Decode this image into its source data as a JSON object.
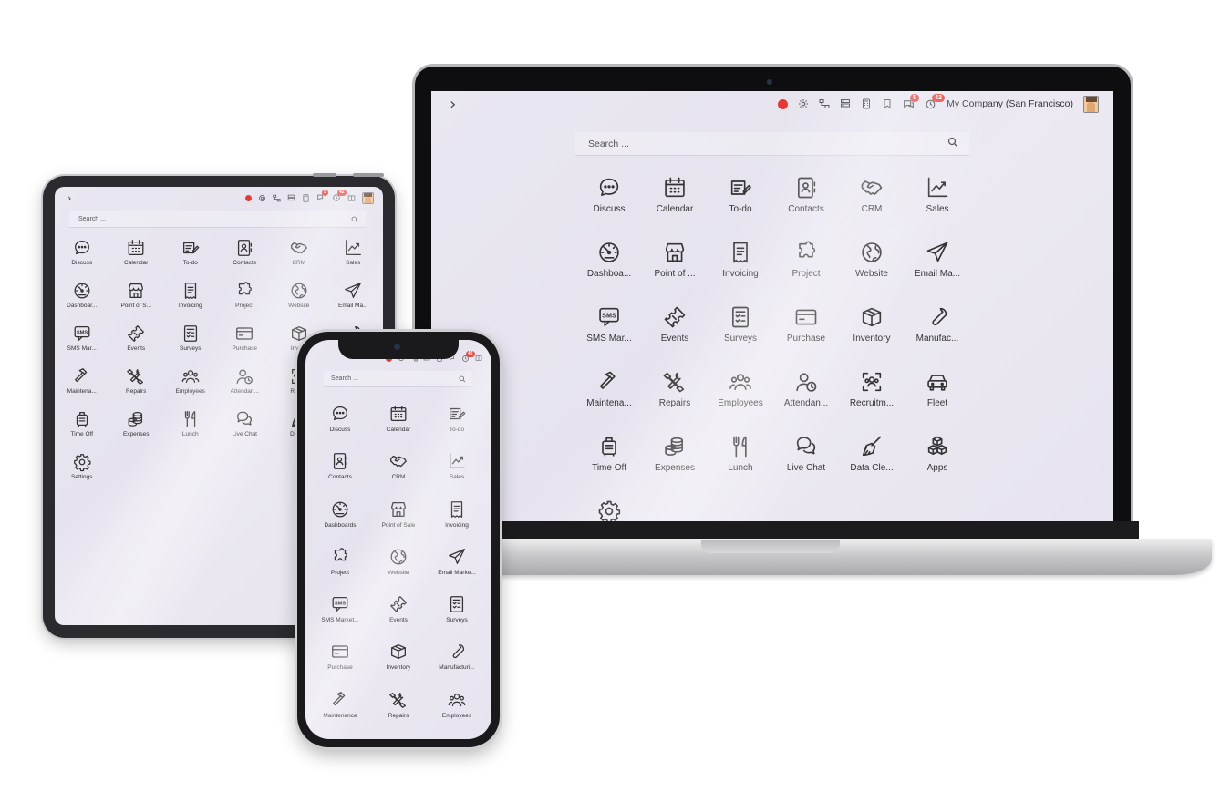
{
  "apps": [
    {
      "name": "Discuss",
      "icon": "chat-bubble-icon"
    },
    {
      "name": "Calendar",
      "icon": "calendar-icon"
    },
    {
      "name": "To-do",
      "icon": "todo-icon"
    },
    {
      "name": "Contacts",
      "icon": "contacts-icon"
    },
    {
      "name": "CRM",
      "icon": "handshake-icon"
    },
    {
      "name": "Sales",
      "icon": "chart-line-icon"
    },
    {
      "name": "Dashboards",
      "icon": "dashboard-gauge-icon"
    },
    {
      "name": "Point of Sale",
      "icon": "storefront-icon"
    },
    {
      "name": "Invoicing",
      "icon": "receipt-icon"
    },
    {
      "name": "Project",
      "icon": "puzzle-icon"
    },
    {
      "name": "Website",
      "icon": "globe-icon"
    },
    {
      "name": "Email Marketing",
      "icon": "paper-plane-icon"
    },
    {
      "name": "SMS Marketing",
      "icon": "sms-icon"
    },
    {
      "name": "Events",
      "icon": "ticket-icon"
    },
    {
      "name": "Surveys",
      "icon": "survey-icon"
    },
    {
      "name": "Purchase",
      "icon": "credit-card-icon"
    },
    {
      "name": "Inventory",
      "icon": "box-icon"
    },
    {
      "name": "Manufacturing",
      "icon": "wrench-icon"
    },
    {
      "name": "Maintenance",
      "icon": "hammer-icon"
    },
    {
      "name": "Repairs",
      "icon": "tools-icon"
    },
    {
      "name": "Employees",
      "icon": "people-icon"
    },
    {
      "name": "Attendances",
      "icon": "person-clock-icon"
    },
    {
      "name": "Recruitment",
      "icon": "recruitment-icon"
    },
    {
      "name": "Fleet",
      "icon": "car-icon"
    },
    {
      "name": "Time Off",
      "icon": "luggage-icon"
    },
    {
      "name": "Expenses",
      "icon": "coins-icon"
    },
    {
      "name": "Lunch",
      "icon": "fork-knife-icon"
    },
    {
      "name": "Live Chat",
      "icon": "chat-dual-icon"
    },
    {
      "name": "Data Cleaning",
      "icon": "broom-icon"
    },
    {
      "name": "Apps",
      "icon": "cubes-icon"
    },
    {
      "name": "Settings",
      "icon": "gear-icon"
    }
  ],
  "laptop": {
    "company": "My Company (San Francisco)",
    "search_placeholder": "Search ...",
    "badge_messages": "5",
    "badge_activities": "42",
    "labels": [
      "Discuss",
      "Calendar",
      "To-do",
      "Contacts",
      "CRM",
      "Sales",
      "Dashboa...",
      "Point of ...",
      "Invoicing",
      "Project",
      "Website",
      "Email Ma...",
      "SMS Mar...",
      "Events",
      "Surveys",
      "Purchase",
      "Inventory",
      "Manufac...",
      "Maintena...",
      "Repairs",
      "Employees",
      "Attendan...",
      "Recruitm...",
      "Fleet",
      "Time Off",
      "Expenses",
      "Lunch",
      "Live Chat",
      "Data Cle...",
      "Apps",
      ""
    ]
  },
  "tablet": {
    "search_placeholder": "Search ...",
    "badge_messages": "5",
    "badge_activities": "42",
    "labels": [
      "Discuss",
      "Calendar",
      "To-do",
      "Contacts",
      "CRM",
      "Sales",
      "Dashboar...",
      "Point of S...",
      "Invoicing",
      "Project",
      "Website",
      "Email Ma...",
      "SMS Mar...",
      "Events",
      "Surveys",
      "Purchase",
      "Inve...",
      "",
      "Maintena...",
      "Repairs",
      "Employees",
      "Attendan...",
      "Recr...",
      "",
      "Time Off",
      "Expenses",
      "Lunch",
      "Live Chat",
      "Data...",
      "",
      "Settings"
    ]
  },
  "phone": {
    "search_placeholder": "Search ...",
    "badge_activities": "42",
    "labels": [
      "Discuss",
      "Calendar",
      "To-do",
      "Contacts",
      "CRM",
      "Sales",
      "Dashboards",
      "Point of Sale",
      "Invoicing",
      "Project",
      "Website",
      "Email Marke...",
      "SMS Market...",
      "Events",
      "Surveys",
      "Purchase",
      "Inventory",
      "Manufacturi...",
      "Maintenance",
      "Repairs",
      "Employees"
    ]
  }
}
